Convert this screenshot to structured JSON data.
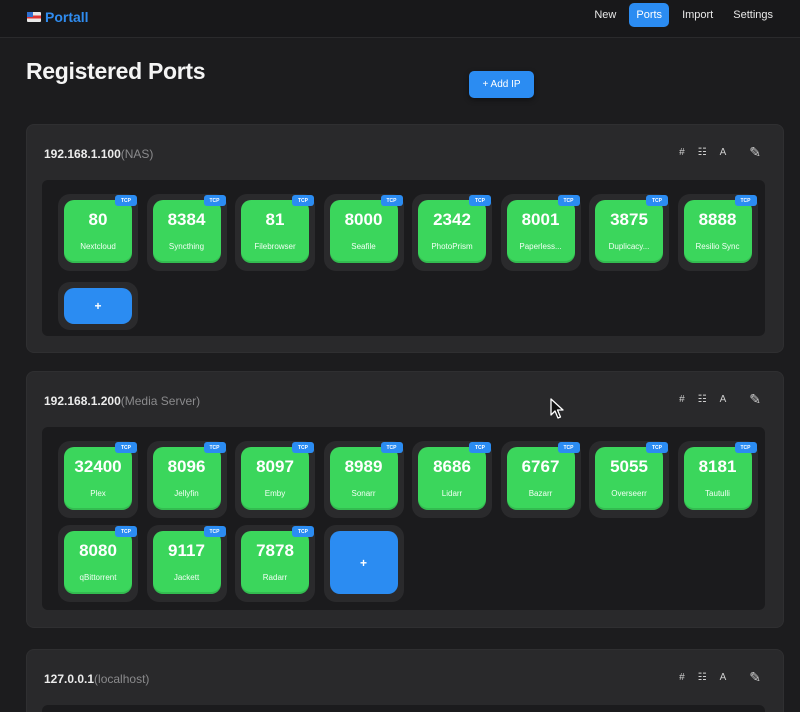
{
  "app": {
    "brand": "Portall",
    "nav": [
      "New",
      "Ports",
      "Import",
      "Settings"
    ],
    "active_nav": "Ports"
  },
  "page": {
    "title": "Registered Ports",
    "add_ip_label": "+ Add IP"
  },
  "action_icons": [
    "hash-icon",
    "network-icon",
    "font-icon",
    "pencil-icon"
  ],
  "action_glyphs": {
    "hash": "#",
    "network": "☷",
    "font": "A",
    "pencil": "✎"
  },
  "add_port_label": "+",
  "colors": {
    "accent": "#2b8cf2",
    "tile": "#3bd65c",
    "background": "#1c1c1e",
    "card": "#29292b"
  },
  "hosts": [
    {
      "ip": "192.168.1.100",
      "alias": "(NAS)",
      "ports": [
        {
          "port": "80",
          "name": "Nextcloud",
          "protocol": "TCP"
        },
        {
          "port": "8384",
          "name": "Syncthing",
          "protocol": "TCP"
        },
        {
          "port": "81",
          "name": "Filebrowser",
          "protocol": "TCP"
        },
        {
          "port": "8000",
          "name": "Seafile",
          "protocol": "TCP"
        },
        {
          "port": "2342",
          "name": "PhotoPrism",
          "protocol": "TCP"
        },
        {
          "port": "8001",
          "name": "Paperless...",
          "protocol": "TCP"
        },
        {
          "port": "3875",
          "name": "Duplicacy...",
          "protocol": "TCP"
        },
        {
          "port": "8888",
          "name": "Resilio Sync",
          "protocol": "TCP"
        }
      ]
    },
    {
      "ip": "192.168.1.200",
      "alias": "(Media Server)",
      "ports": [
        {
          "port": "32400",
          "name": "Plex",
          "protocol": "TCP"
        },
        {
          "port": "8096",
          "name": "Jellyfin",
          "protocol": "TCP"
        },
        {
          "port": "8097",
          "name": "Emby",
          "protocol": "TCP"
        },
        {
          "port": "8989",
          "name": "Sonarr",
          "protocol": "TCP"
        },
        {
          "port": "8686",
          "name": "Lidarr",
          "protocol": "TCP"
        },
        {
          "port": "6767",
          "name": "Bazarr",
          "protocol": "TCP"
        },
        {
          "port": "5055",
          "name": "Overseerr",
          "protocol": "TCP"
        },
        {
          "port": "8181",
          "name": "Tautulli",
          "protocol": "TCP"
        },
        {
          "port": "8080",
          "name": "qBittorrent",
          "protocol": "TCP"
        },
        {
          "port": "9117",
          "name": "Jackett",
          "protocol": "TCP"
        },
        {
          "port": "7878",
          "name": "Radarr",
          "protocol": "TCP"
        }
      ]
    },
    {
      "ip": "127.0.0.1",
      "alias": "(localhost)",
      "ports": []
    }
  ]
}
